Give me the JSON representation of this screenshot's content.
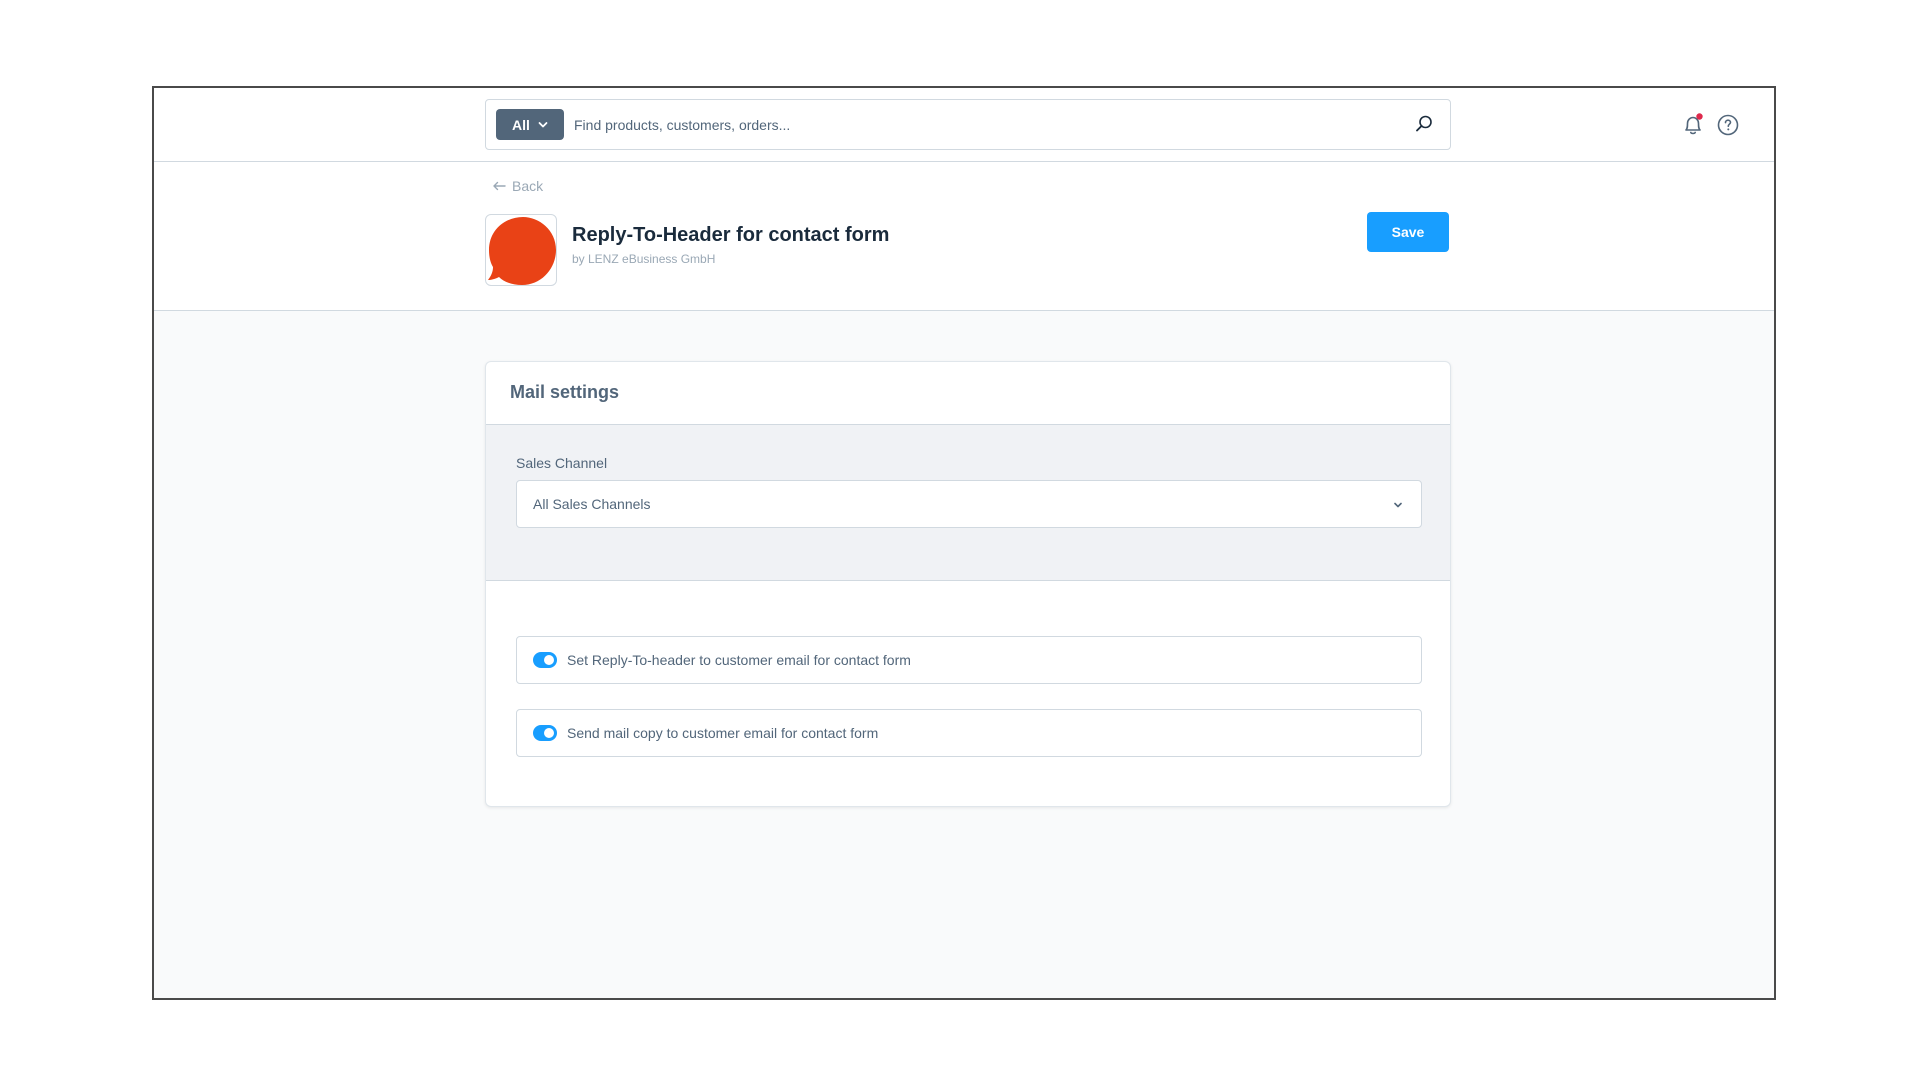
{
  "search": {
    "type_label": "All",
    "placeholder": "Find products, customers, orders..."
  },
  "header": {
    "back_label": "Back",
    "title": "Reply-To-Header for contact form",
    "author": "by LENZ eBusiness GmbH",
    "save_label": "Save"
  },
  "card": {
    "title": "Mail settings",
    "sales_channel": {
      "label": "Sales Channel",
      "value": "All Sales Channels"
    },
    "toggles": [
      {
        "label": "Set Reply-To-header to customer email for contact form",
        "enabled": true
      },
      {
        "label": "Send mail copy to customer email for contact form",
        "enabled": true
      }
    ]
  },
  "colors": {
    "accent": "#189eff",
    "plugin_icon": "#e94216",
    "notification_dot": "#de294c",
    "search_type_bg": "#52667a"
  },
  "icons": {
    "search": "search-icon",
    "bell": "bell-icon",
    "help": "help-icon",
    "back": "arrow-left-icon",
    "chevron": "chevron-down-icon"
  }
}
